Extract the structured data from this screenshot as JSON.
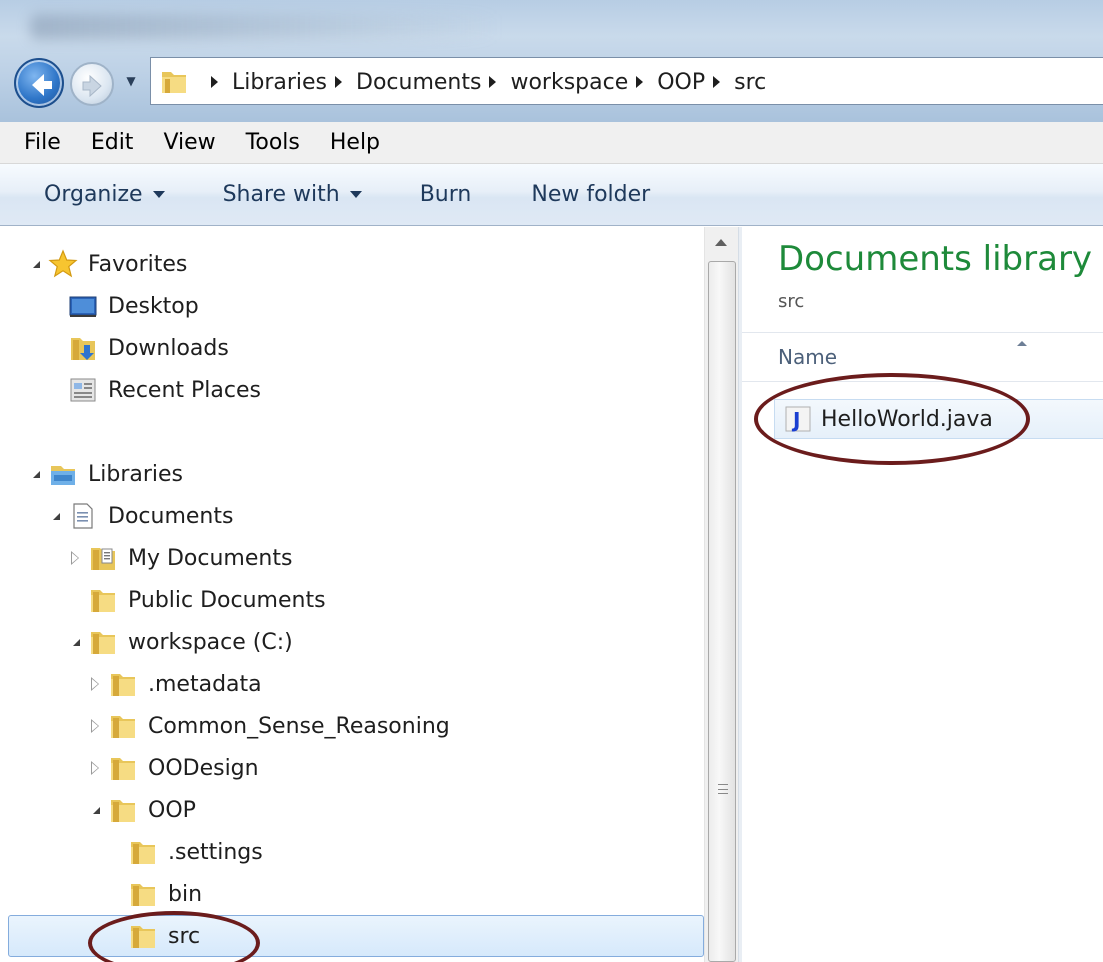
{
  "window": {
    "address": {
      "crumbs": [
        "Libraries",
        "Documents",
        "workspace",
        "OOP",
        "src"
      ]
    }
  },
  "menubar": {
    "items": [
      "File",
      "Edit",
      "View",
      "Tools",
      "Help"
    ]
  },
  "commandbar": {
    "organize": "Organize",
    "share_with": "Share with",
    "burn": "Burn",
    "new_folder": "New folder"
  },
  "navpane": {
    "favorites": "Favorites",
    "desktop": "Desktop",
    "downloads": "Downloads",
    "recent_places": "Recent Places",
    "libraries": "Libraries",
    "documents": "Documents",
    "my_documents": "My Documents",
    "public_documents": "Public Documents",
    "workspace": "workspace (C:)",
    "metadata": ".metadata",
    "common_sense": "Common_Sense_Reasoning",
    "oodesign": "OODesign",
    "oop": "OOP",
    "settings": ".settings",
    "bin": "bin",
    "src": "src"
  },
  "content": {
    "title": "Documents library",
    "subtitle": "src",
    "column_name": "Name",
    "files": [
      {
        "name": "HelloWorld.java",
        "icon": "java-file-icon"
      }
    ]
  },
  "colors": {
    "library_title": "#1e8a3a",
    "annotation_oval": "#6b1c1c",
    "selection": "#d6e9fb"
  }
}
